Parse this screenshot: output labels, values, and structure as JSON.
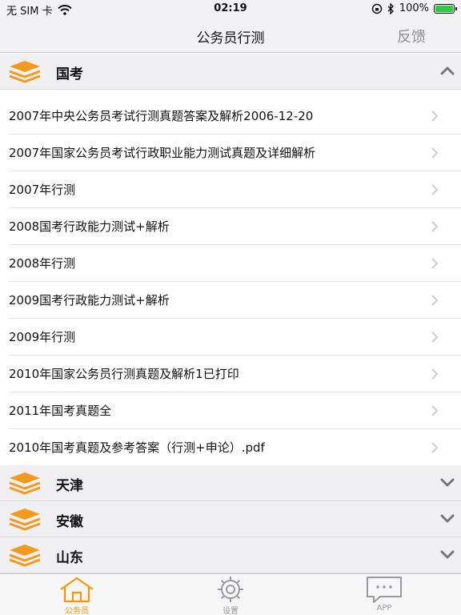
{
  "status_bar": {
    "carrier": "无 SIM 卡",
    "time": "02:19",
    "battery": "100%",
    "battery_level": 1.0
  },
  "nav": {
    "title": "公务员行测",
    "feedback": "反馈"
  },
  "sections": [
    {
      "label": "国考",
      "expanded": true,
      "items": [
        "2007年中央公务员考试行测真题答案及解析2006-12-20",
        "2007年国家公务员考试行政职业能力测试真题及详细解析",
        "2007年行测",
        "2008国考行政能力测试+解析",
        "2008年行测",
        "2009国考行政能力测试+解析",
        "2009年行测",
        "2010年国家公务员行测真题及解析1已打印",
        "2011年国考真题全",
        "2010年国考真题及参考答案（行测+申论）.pdf"
      ]
    },
    {
      "label": "天津",
      "expanded": false
    },
    {
      "label": "安徽",
      "expanded": false
    },
    {
      "label": "山东",
      "expanded": false
    }
  ],
  "tabs": [
    {
      "label": "公务员",
      "icon": "home-icon",
      "active": true
    },
    {
      "label": "设置",
      "icon": "gear-icon",
      "active": false
    },
    {
      "label": "APP",
      "icon": "chat-bubble-icon",
      "active": false
    }
  ],
  "colors": {
    "accent": "#ff9500",
    "section_bg": "#f0f0f2",
    "chevron": "#c7c7cc"
  }
}
